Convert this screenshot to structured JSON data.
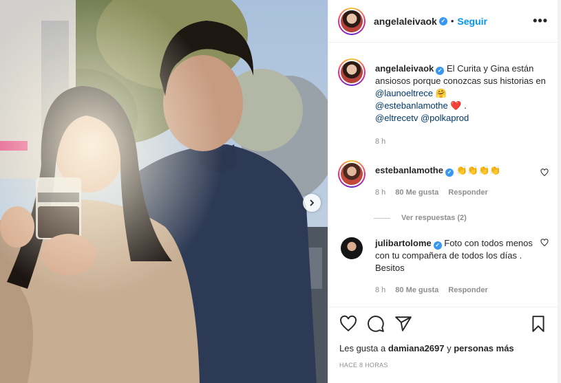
{
  "post": {
    "author": "angelaleivaok",
    "separator": "•",
    "follow_label": "Seguir",
    "more_label": "•••"
  },
  "caption": {
    "username": "angelaleivaok",
    "text_1": " El Curita y Gina están ansiosos porque conozcas sus historias en ",
    "mention_1": "@launoeltrece",
    "emoji_1": "🤗",
    "mention_2": "@estebanlamothe",
    "emoji_2": "❤️",
    "text_2": ".",
    "mention_3": "@eltrecetv",
    "mention_4": "@polkaprod",
    "time": "8 h"
  },
  "comments": [
    {
      "username": "estebanlamothe",
      "text": "👏👏👏👏",
      "time": "8 h",
      "likes": "80 Me gusta",
      "reply": "Responder",
      "view_replies": "Ver respuestas (2)"
    },
    {
      "username": "julibartolome",
      "text": "Foto con todos menos con tu compañera de todos los días . Besitos",
      "time": "8 h",
      "likes": "80 Me gusta",
      "reply": "Responder"
    }
  ],
  "likes": {
    "prefix": "Les gusta a ",
    "user": "damiana2697",
    "middle": " y ",
    "others": "personas más"
  },
  "timestamp": "HACE 8 HORAS",
  "icons": {
    "like": "heart-icon",
    "comment": "comment-icon",
    "share": "share-icon",
    "save": "bookmark-icon",
    "next": "chevron-right-icon",
    "verified": "verified-badge-icon"
  },
  "colors": {
    "accent": "#0095f6",
    "verified": "#3897f0",
    "text": "#262626",
    "muted": "#8e8e8e"
  }
}
